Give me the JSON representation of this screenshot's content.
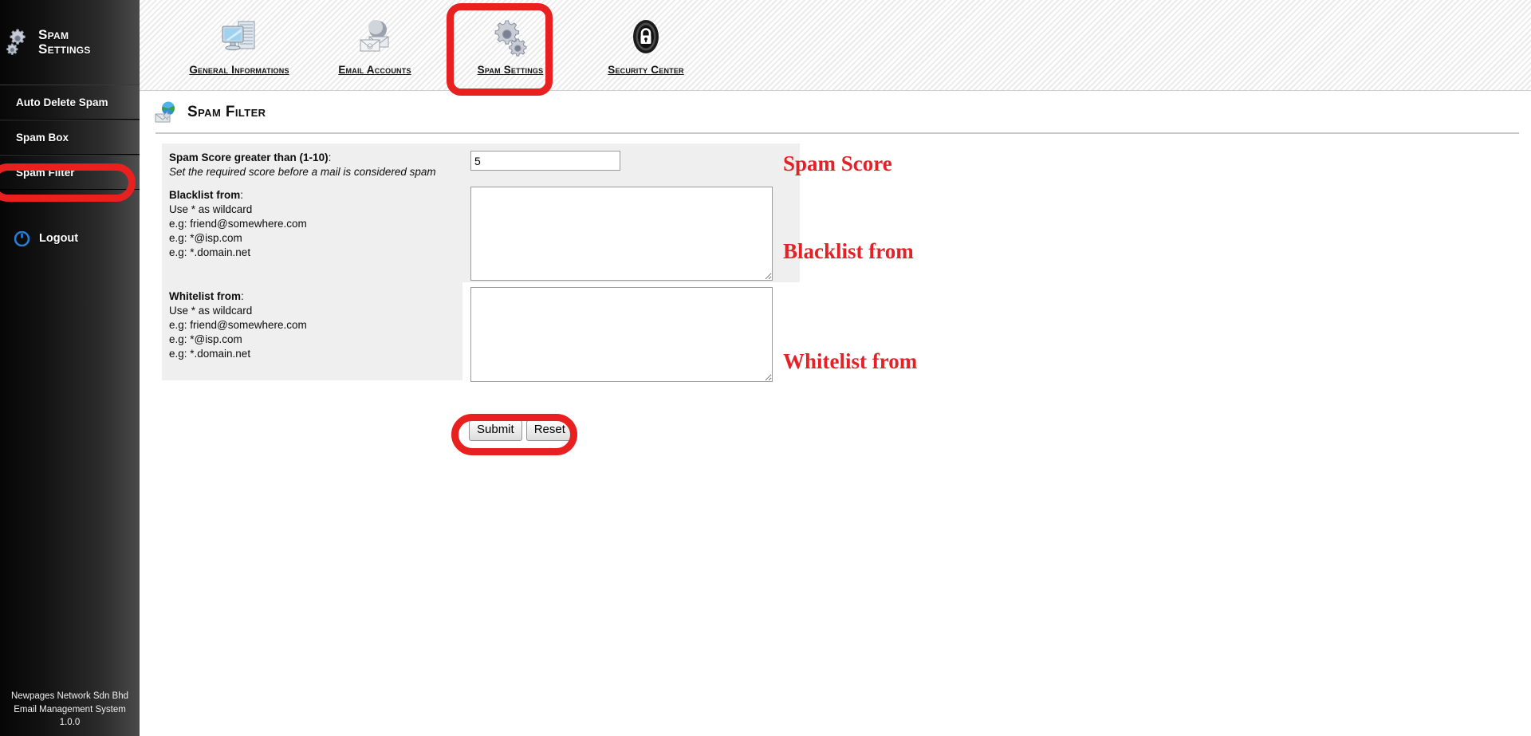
{
  "sidebar": {
    "brand_title_line1": "Spam",
    "brand_title_line2": "Settings",
    "brand_icon": "gears-icon",
    "items": [
      {
        "label": "Auto Delete Spam",
        "name": "sidebar-item-auto-delete-spam",
        "active": false
      },
      {
        "label": "Spam Box",
        "name": "sidebar-item-spam-box",
        "active": false
      },
      {
        "label": "Spam Filter",
        "name": "sidebar-item-spam-filter",
        "active": true
      }
    ],
    "logout_label": "Logout",
    "logout_icon": "power-icon",
    "footer": {
      "line1": "Newpages Network Sdn Bhd",
      "line2": "Email Management System",
      "line3": "1.0.0"
    }
  },
  "topnav": {
    "tabs": [
      {
        "label": "General Informations",
        "icon": "monitor-server-icon",
        "active": false
      },
      {
        "label": "Email Accounts",
        "icon": "envelope-globe-icon",
        "active": false
      },
      {
        "label": "Spam Settings",
        "icon": "gears-icon",
        "active": true
      },
      {
        "label": "Security Center",
        "icon": "lock-shield-icon",
        "active": false
      }
    ]
  },
  "page": {
    "title": "Spam Filter",
    "title_icon": "globe-envelope-icon"
  },
  "form": {
    "score": {
      "label": "Spam Score greater than (1-10)",
      "label_suffix": ":",
      "hint": "Set the required score before a mail is considered spam",
      "value": "5",
      "placeholder": ""
    },
    "blacklist": {
      "label": "Blacklist from",
      "label_suffix": ":",
      "hints": [
        "Use * as wildcard",
        "e.g: friend@somewhere.com",
        "e.g: *@isp.com",
        "e.g: *.domain.net"
      ],
      "value": "",
      "placeholder": ""
    },
    "whitelist": {
      "label": "Whitelist from",
      "label_suffix": ":",
      "hints": [
        "Use * as wildcard",
        "e.g: friend@somewhere.com",
        "e.g: *@isp.com",
        "e.g: *.domain.net"
      ],
      "value": "",
      "placeholder": ""
    },
    "submit_label": "Submit",
    "reset_label": "Reset"
  },
  "annotations": {
    "color": "#e32227",
    "highlight_color": "#e8201f",
    "spam_score": "Spam Score",
    "blacklist": "Blacklist from",
    "whitelist": "Whitelist from"
  }
}
